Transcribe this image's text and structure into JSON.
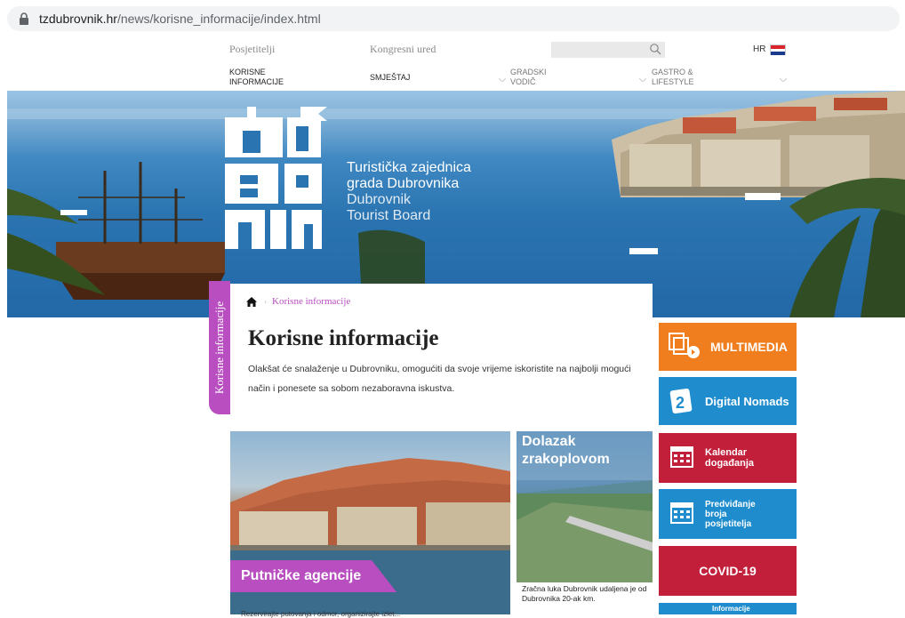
{
  "browser": {
    "url_domain": "tzdubrovnik.hr",
    "url_path": "/news/korisne_informacije/index.html"
  },
  "top_links": {
    "visitors": "Posjetitelji",
    "congress": "Kongresni ured"
  },
  "search": {
    "placeholder": ""
  },
  "language": "HR",
  "main_nav": [
    {
      "line1": "KORISNE",
      "line2": "INFORMACIJE"
    },
    {
      "line1": "SMJEŠTAJ",
      "line2": ""
    },
    {
      "line1": "GRADSKI",
      "line2": "VODIČ"
    },
    {
      "line1": "GASTRO &",
      "line2": "LIFESTYLE"
    }
  ],
  "hero": {
    "logo_lines": [
      "Turistička zajednica",
      "grada Dubrovnika",
      "Dubrovnik",
      "Tourist Board"
    ]
  },
  "side_tab": "Korisne informacije",
  "breadcrumb": {
    "current": "Korisne informacije"
  },
  "page": {
    "title": "Korisne informacije",
    "intro": "Olakšat će snalaženje u Dubrovniku, omogućiti da svoje vrijeme iskoristite na najbolji mogući način i ponesete sa sobom nezaboravna iskustva."
  },
  "cards": [
    {
      "label": "Putničke agencije",
      "sub": "Rezervirajte putovanja i odmor, organizirajte izlet..."
    },
    {
      "title_line1": "Dolazak",
      "title_line2": "zrakoplovom",
      "desc": "Zračna luka Dubrovnik udaljena je od Dubrovnika 20-ak km."
    }
  ],
  "tiles": {
    "multimedia": "MULTIMEDIA",
    "nomads": "Digital Nomads",
    "calendar": [
      "Kalendar",
      "događanja"
    ],
    "prediction": [
      "Predviđanje",
      "broja",
      "posjetitelja"
    ],
    "covid": "COVID-19",
    "info": "Informacije"
  },
  "colors": {
    "accent_purple": "#b84ec0",
    "orange": "#f07d1e",
    "blue": "#1e8ccd",
    "red": "#c21f3a"
  }
}
